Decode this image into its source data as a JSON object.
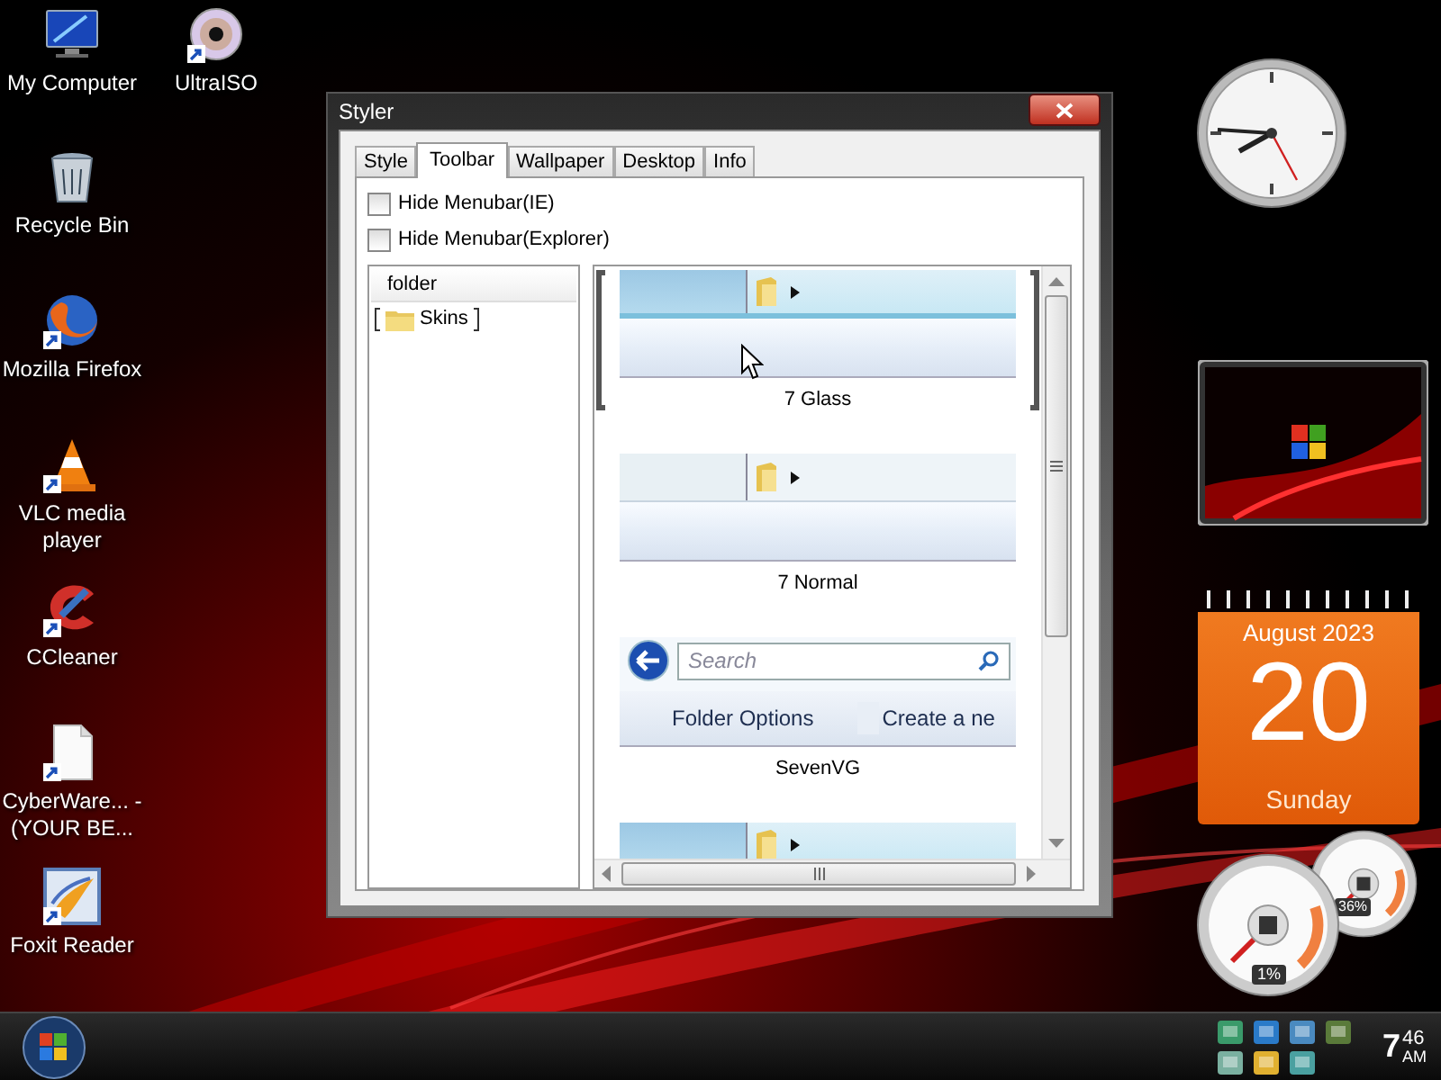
{
  "desktop_icons": [
    [
      {
        "label": "My Computer",
        "kind": "computer",
        "shortcut": false
      },
      {
        "label": "Recycle Bin",
        "kind": "trash",
        "shortcut": false
      },
      {
        "label": "Mozilla Firefox",
        "kind": "browser",
        "shortcut": true
      },
      {
        "label": "VLC media player",
        "kind": "cone",
        "shortcut": true
      },
      {
        "label": "CCleaner",
        "kind": "cleaner",
        "shortcut": true
      },
      {
        "label": "CyberWare... - (YOUR BE...",
        "kind": "document",
        "shortcut": true
      },
      {
        "label": "Foxit Reader",
        "kind": "pdf",
        "shortcut": true
      }
    ],
    [
      {
        "label": "UltraISO",
        "kind": "disc",
        "shortcut": true
      }
    ]
  ],
  "window": {
    "title": "Styler",
    "tabs": [
      {
        "label": "Style",
        "selected": false
      },
      {
        "label": "Toolbar",
        "selected": true
      },
      {
        "label": "Wallpaper",
        "selected": false
      },
      {
        "label": "Desktop",
        "selected": false
      },
      {
        "label": "Info",
        "selected": false
      }
    ],
    "options": [
      {
        "label": "Hide Menubar(IE)",
        "checked": false
      },
      {
        "label": "Hide Menubar(Explorer)",
        "checked": false
      }
    ],
    "tree": {
      "header": "folder",
      "items": [
        {
          "label": "Skins",
          "selected": true
        }
      ]
    },
    "skins": [
      {
        "name": "7 Glass",
        "kind": "glass",
        "selected": true
      },
      {
        "name": "7 Normal",
        "kind": "normal",
        "selected": false
      },
      {
        "name": "SevenVG",
        "kind": "search",
        "selected": false,
        "search_placeholder": "Search",
        "buttons": [
          "Folder Options",
          "Create a ne"
        ]
      },
      {
        "kind": "glass",
        "selected": false
      }
    ]
  },
  "gadgets": {
    "calendar": {
      "month_year": "August 2023",
      "day": "20",
      "weekday": "Sunday"
    },
    "meters": [
      {
        "reading": "1%"
      },
      {
        "reading": "36%"
      }
    ]
  },
  "taskbar": {
    "time_hour": "7",
    "time_minutes": "46",
    "time_period": "AM"
  }
}
